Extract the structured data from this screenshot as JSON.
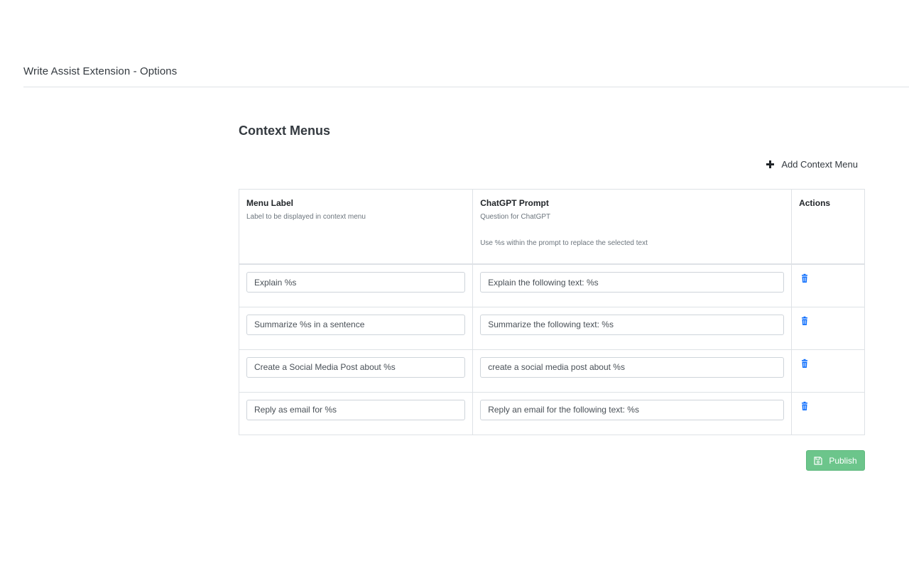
{
  "header": {
    "title": "Write Assist Extension - Options"
  },
  "section": {
    "title": "Context Menus",
    "add_label": "Add Context Menu"
  },
  "table": {
    "columns": {
      "label": {
        "title": "Menu Label",
        "subtitle": "Label to be displayed in context menu"
      },
      "prompt": {
        "title": "ChatGPT Prompt",
        "subtitle": "Question for ChatGPT",
        "note": "Use %s within the prompt to replace the selected text"
      },
      "actions": {
        "title": "Actions"
      }
    },
    "rows": [
      {
        "label": "Explain %s",
        "prompt": "Explain the following text: %s"
      },
      {
        "label": "Summarize %s in a sentence",
        "prompt": "Summarize the following text: %s"
      },
      {
        "label": "Create a Social Media Post about %s",
        "prompt": "create a social media post about %s"
      },
      {
        "label": "Reply as email for %s",
        "prompt": "Reply an email for the following text: %s"
      }
    ]
  },
  "publish": {
    "label": "Publish"
  },
  "icons": {
    "add": "plus-icon",
    "delete": "trash-icon",
    "publish": "save-icon"
  },
  "colors": {
    "accent_blue": "#0d6efd",
    "publish_green": "#6cc58b"
  }
}
